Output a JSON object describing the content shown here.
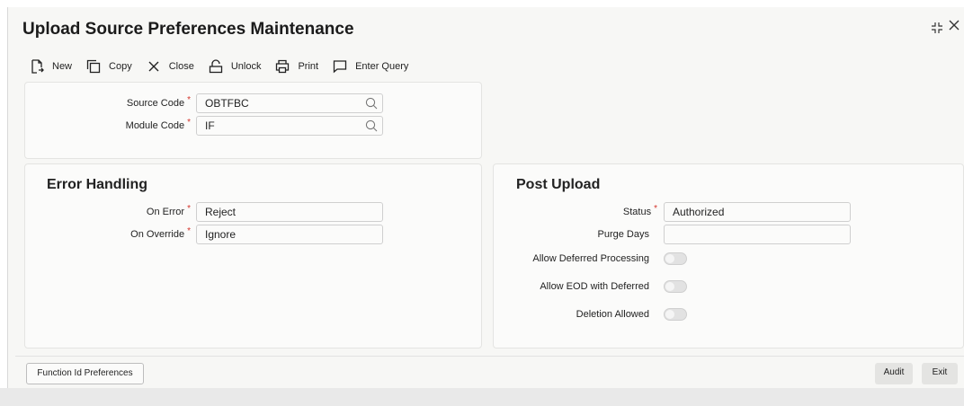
{
  "title": "Upload Source Preferences Maintenance",
  "toolbar": {
    "new": "New",
    "copy": "Copy",
    "close": "Close",
    "unlock": "Unlock",
    "print": "Print",
    "enter_query": "Enter Query"
  },
  "header": {
    "source_code": {
      "label": "Source Code",
      "value": "OBTFBC"
    },
    "module_code": {
      "label": "Module Code",
      "value": "IF"
    }
  },
  "error_handling": {
    "title": "Error Handling",
    "on_error": {
      "label": "On Error",
      "value": "Reject"
    },
    "on_override": {
      "label": "On Override",
      "value": "Ignore"
    }
  },
  "post_upload": {
    "title": "Post Upload",
    "status": {
      "label": "Status",
      "value": "Authorized"
    },
    "purge_days": {
      "label": "Purge Days",
      "value": ""
    },
    "allow_deferred": {
      "label": "Allow Deferred Processing",
      "checked": false
    },
    "allow_eod": {
      "label": "Allow EOD with Deferred",
      "checked": false
    },
    "deletion_allowed": {
      "label": "Deletion Allowed",
      "checked": false
    }
  },
  "footer": {
    "function_id_prefs": "Function Id Preferences",
    "audit": "Audit",
    "exit": "Exit"
  },
  "colors": {
    "required": "#d4352c"
  }
}
